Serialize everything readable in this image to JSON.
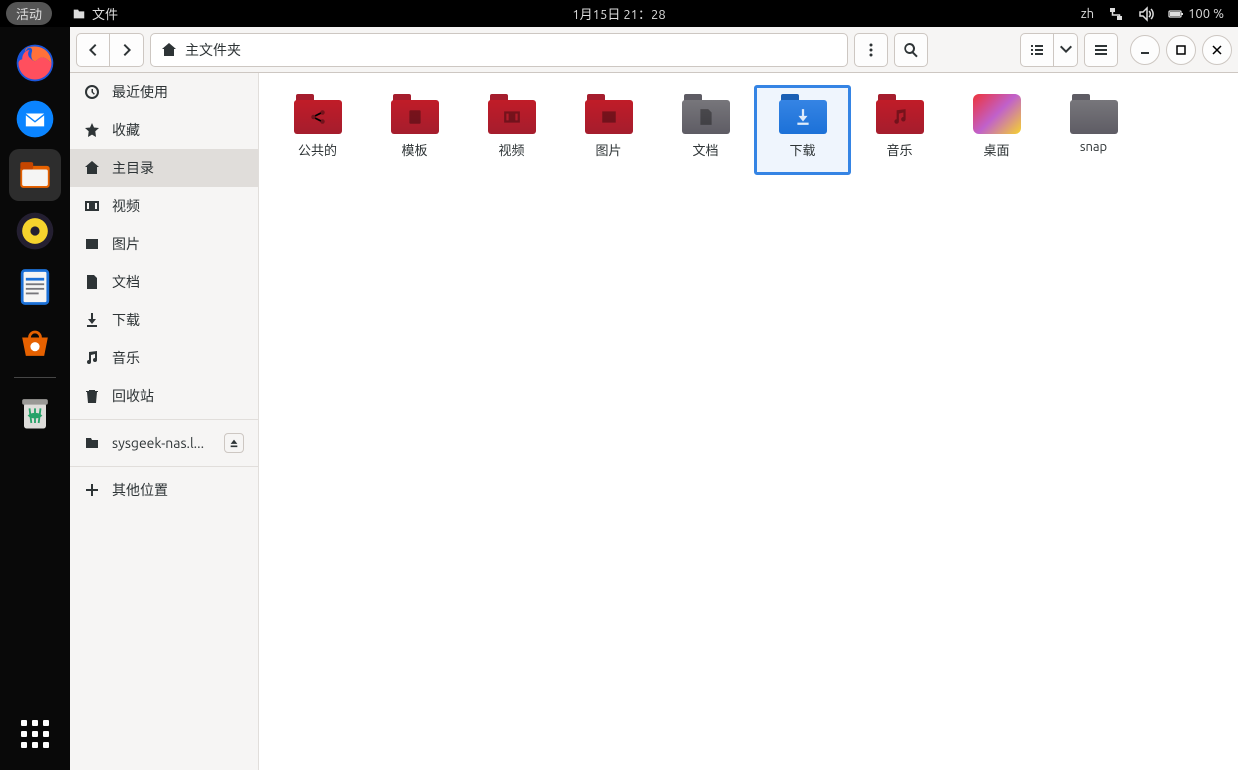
{
  "top_panel": {
    "activities": "活动",
    "app_name": "文件",
    "datetime": "1月15日  21：28",
    "input_method": "zh",
    "battery": "100 %"
  },
  "dock": {
    "items": [
      "firefox",
      "thunderbird",
      "files",
      "rhythmbox",
      "writer",
      "software",
      "trash"
    ],
    "active": "files"
  },
  "headerbar": {
    "path_label": "主文件夹"
  },
  "sidebar": {
    "items": [
      {
        "id": "recent",
        "label": "最近使用",
        "icon": "clock"
      },
      {
        "id": "starred",
        "label": "收藏",
        "icon": "star"
      },
      {
        "id": "home",
        "label": "主目录",
        "icon": "home",
        "active": true
      },
      {
        "id": "videos",
        "label": "视频",
        "icon": "video"
      },
      {
        "id": "pictures",
        "label": "图片",
        "icon": "picture"
      },
      {
        "id": "documents",
        "label": "文档",
        "icon": "document"
      },
      {
        "id": "downloads",
        "label": "下载",
        "icon": "download"
      },
      {
        "id": "music",
        "label": "音乐",
        "icon": "music"
      },
      {
        "id": "trash",
        "label": "回收站",
        "icon": "trash"
      }
    ],
    "network_item": {
      "label": "sysgeek-nas.l..."
    },
    "other_locations": "其他位置"
  },
  "folders": [
    {
      "id": "public",
      "label": "公共的",
      "color": "red",
      "glyph": "share"
    },
    {
      "id": "templates",
      "label": "模板",
      "color": "red",
      "glyph": "template"
    },
    {
      "id": "videos",
      "label": "视频",
      "color": "red",
      "glyph": "video"
    },
    {
      "id": "pictures",
      "label": "图片",
      "color": "red",
      "glyph": "picture"
    },
    {
      "id": "documents",
      "label": "文档",
      "color": "gray",
      "glyph": "document"
    },
    {
      "id": "downloads",
      "label": "下载",
      "color": "blue",
      "glyph": "download",
      "selected": true
    },
    {
      "id": "music",
      "label": "音乐",
      "color": "red",
      "glyph": "music"
    },
    {
      "id": "desktop",
      "label": "桌面",
      "color": "gradient",
      "glyph": ""
    },
    {
      "id": "snap",
      "label": "snap",
      "color": "gray",
      "glyph": ""
    }
  ]
}
